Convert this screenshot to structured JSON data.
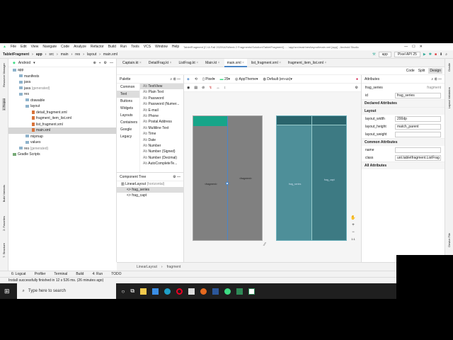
{
  "menu": {
    "items": [
      "File",
      "Edit",
      "View",
      "Navigate",
      "Code",
      "Analyze",
      "Refactor",
      "Build",
      "Run",
      "Tools",
      "VCS",
      "Window",
      "Help"
    ],
    "title": "TabletFragment [C:\\A Fall 2020\\A2\\Week 2 Fragments\\Solution\\TabletFragment] - ...\\app\\src\\main\\res\\layout\\main.xml [app] - Android Studio"
  },
  "breadcrumb": [
    "TabletFragment",
    "app",
    "src",
    "main",
    "res",
    "layout",
    "main.xml"
  ],
  "run": {
    "config": "app",
    "device": "Pixel API 25"
  },
  "project": {
    "view": "Android",
    "tree": [
      {
        "label": "app",
        "depth": 0,
        "type": "folder"
      },
      {
        "label": "manifests",
        "depth": 1,
        "type": "folder"
      },
      {
        "label": "java",
        "depth": 1,
        "type": "folder"
      },
      {
        "label": "java",
        "suffix": "(generated)",
        "depth": 1,
        "type": "folder"
      },
      {
        "label": "res",
        "depth": 1,
        "type": "folder"
      },
      {
        "label": "drawable",
        "depth": 2,
        "type": "folder"
      },
      {
        "label": "layout",
        "depth": 2,
        "type": "folder"
      },
      {
        "label": "detail_fragment.xml",
        "depth": 3,
        "type": "xml"
      },
      {
        "label": "fragment_item_list.xml",
        "depth": 3,
        "type": "xml"
      },
      {
        "label": "list_fragment.xml",
        "depth": 3,
        "type": "xml"
      },
      {
        "label": "main.xml",
        "depth": 3,
        "type": "xml",
        "selected": true
      },
      {
        "label": "mipmap",
        "depth": 2,
        "type": "folder"
      },
      {
        "label": "values",
        "depth": 2,
        "type": "folder"
      },
      {
        "label": "res",
        "suffix": "(generated)",
        "depth": 1,
        "type": "folder"
      },
      {
        "label": "Gradle Scripts",
        "depth": 0,
        "type": "gradle"
      }
    ]
  },
  "left_strip": [
    "Resource Manager",
    "1: Project",
    "Build Variants",
    "2: Favorites",
    "7: Structure"
  ],
  "right_strip": [
    "Gradle",
    "Layout Validation",
    "Device File"
  ],
  "tabs": [
    "Captain.kt",
    "DetailFrag.kt",
    "ListFrag.kt",
    "Main.kt",
    "main.xml",
    "list_fragment.xml",
    "fragment_item_list.xml"
  ],
  "active_tab": "main.xml",
  "modes": [
    "Code",
    "Split",
    "Design"
  ],
  "palette": {
    "title": "Palette",
    "categories": [
      "Common",
      "Text",
      "Buttons",
      "Widgets",
      "Layouts",
      "Containers",
      "Google",
      "Legacy"
    ],
    "selected_category": "Text",
    "items": [
      "TextView",
      "Plain Text",
      "Password",
      "Password (Numer...",
      "E-mail",
      "Phone",
      "Postal Address",
      "Multiline Text",
      "Time",
      "Date",
      "Number",
      "Number (Signed)",
      "Number (Decimal)",
      "AutoCompleteTe..."
    ]
  },
  "component_tree": {
    "title": "Component Tree",
    "root": "LinearLayout",
    "root_suffix": "(horizontal)",
    "children": [
      "frag_series",
      "frag_capt"
    ]
  },
  "design_toolbar": {
    "device": "Pixel",
    "api": "29",
    "theme": "AppTheme",
    "locale": "Default (en-us)"
  },
  "canvas": {
    "design_labels": [
      "<fragment>",
      "<fragment>"
    ],
    "blueprint_labels": [
      "frag_series",
      "frag_capt"
    ]
  },
  "attributes": {
    "title": "Attributes",
    "element": "frag_series",
    "element_type": "fragment",
    "id_label": "id",
    "id": "frag_series",
    "declared": "Declared Attributes",
    "layout": "Layout",
    "layout_rows": [
      {
        "k": "layout_width",
        "v": "200dp"
      },
      {
        "k": "layout_height",
        "v": "match_parent"
      },
      {
        "k": "layout_weight",
        "v": ""
      }
    ],
    "common": "Common Attributes",
    "common_rows": [
      {
        "k": "name",
        "v": ""
      },
      {
        "k": "class",
        "v": "uot.tabletfragment.ListFrag"
      }
    ],
    "all": "All Attributes"
  },
  "bottom_breadcrumb": [
    "LinearLayout",
    "fragment"
  ],
  "tool_windows": [
    "6: Logcat",
    "Profiler",
    "Terminal",
    "Build",
    "4: Run",
    "TODO"
  ],
  "status": "Install successfully finished in 12 s 526 ms. (26 minutes ago)",
  "taskbar": {
    "search_placeholder": "Type here to search"
  }
}
